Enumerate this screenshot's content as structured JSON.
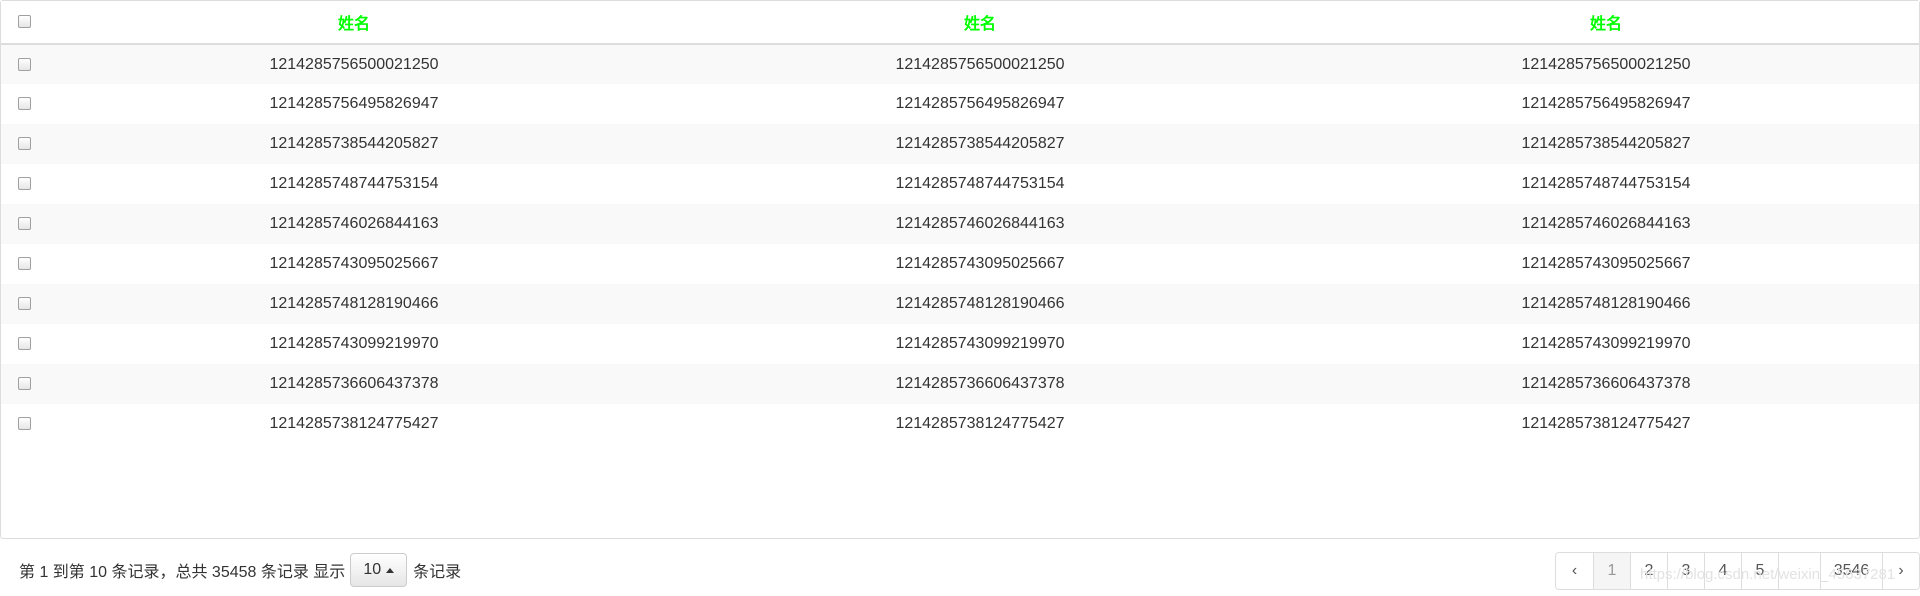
{
  "table": {
    "headers": [
      "姓名",
      "姓名",
      "姓名"
    ],
    "rows": [
      [
        "1214285756500021250",
        "1214285756500021250",
        "1214285756500021250"
      ],
      [
        "1214285756495826947",
        "1214285756495826947",
        "1214285756495826947"
      ],
      [
        "1214285738544205827",
        "1214285738544205827",
        "1214285738544205827"
      ],
      [
        "1214285748744753154",
        "1214285748744753154",
        "1214285748744753154"
      ],
      [
        "1214285746026844163",
        "1214285746026844163",
        "1214285746026844163"
      ],
      [
        "1214285743095025667",
        "1214285743095025667",
        "1214285743095025667"
      ],
      [
        "1214285748128190466",
        "1214285748128190466",
        "1214285748128190466"
      ],
      [
        "1214285743099219970",
        "1214285743099219970",
        "1214285743099219970"
      ],
      [
        "1214285736606437378",
        "1214285736606437378",
        "1214285736606437378"
      ],
      [
        "1214285738124775427",
        "1214285738124775427",
        "1214285738124775427"
      ]
    ]
  },
  "footer": {
    "info_text": "第 1 到第 10 条记录，总共 35458 条记录 显示",
    "page_size": "10",
    "suffix_text": "条记录"
  },
  "pagination": {
    "prev": "‹",
    "pages": [
      "1",
      "2",
      "3",
      "4",
      "5"
    ],
    "ellipsis": "",
    "last_page": "3546",
    "next": "›"
  },
  "watermark": "https://blog.csdn.net/weixin_45637281",
  "colors": {
    "header_text": "#00ff00",
    "striped_row": "#f9f9f9"
  }
}
